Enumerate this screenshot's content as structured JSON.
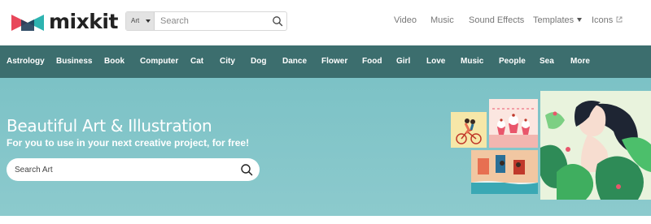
{
  "header": {
    "logo_text": "mixkit",
    "search": {
      "category": "Art",
      "placeholder": "Search"
    },
    "nav": [
      {
        "label": "Video"
      },
      {
        "label": "Music"
      },
      {
        "label": "Sound Effects"
      },
      {
        "label": "Templates"
      },
      {
        "label": "Icons"
      }
    ]
  },
  "categories": [
    "Astrology",
    "Business",
    "Book",
    "Computer",
    "Cat",
    "City",
    "Dog",
    "Dance",
    "Flower",
    "Food",
    "Girl",
    "Love",
    "Music",
    "People",
    "Sea",
    "More"
  ],
  "hero": {
    "title": "Beautiful Art & Illustration",
    "subtitle": "For you to use in your next creative project, for free!",
    "search_placeholder": "Search Art"
  },
  "colors": {
    "category_bar": "#3c6e6e",
    "hero_bg": "#7cc2c6",
    "logo_red": "#e8475a",
    "logo_teal": "#2db3b0"
  }
}
